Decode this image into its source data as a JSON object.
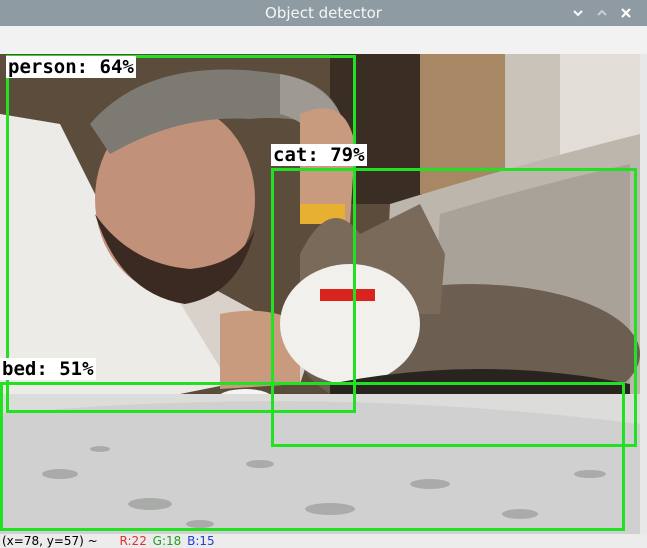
{
  "window": {
    "title": "Object detector"
  },
  "controls": [
    "chevron-down-icon",
    "chevron-up-icon",
    "close-icon"
  ],
  "detections": [
    {
      "label": "person: 64%",
      "class": "person",
      "confidence": 64
    },
    {
      "label": "cat: 79%",
      "class": "cat",
      "confidence": 79
    },
    {
      "label": "bed: 51%",
      "class": "bed",
      "confidence": 51
    }
  ],
  "status": {
    "coords": "(x=78, y=57) ~",
    "r": "R:22",
    "g": "G:18",
    "b": "B:15"
  },
  "colors": {
    "box": "#22e022",
    "titlebar": "#8f9ba3",
    "r_text": "#e03030",
    "g_text": "#20a020",
    "b_text": "#2040e0"
  }
}
